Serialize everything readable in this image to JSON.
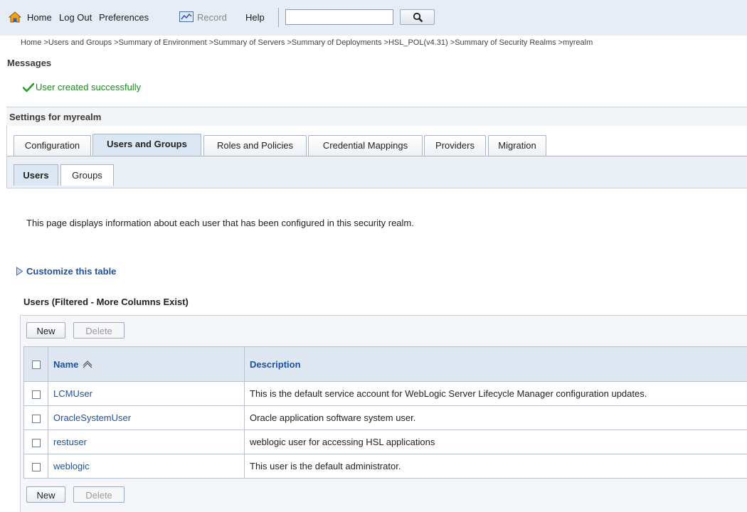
{
  "toolbar": {
    "home": "Home",
    "logout": "Log Out",
    "preferences": "Preferences",
    "record": "Record",
    "help": "Help",
    "search_value": ""
  },
  "breadcrumb": [
    "Home >",
    "Users and Groups >",
    "Summary of Environment >",
    "Summary of Servers >",
    "Summary of Deployments >",
    "HSL_POL(v4.31) >",
    "Summary of Security Realms >",
    "myrealm"
  ],
  "messages": {
    "heading": "Messages",
    "success": "User created successfully"
  },
  "settings": {
    "title": "Settings for myrealm"
  },
  "tabs": [
    "Configuration",
    "Users and Groups",
    "Roles and Policies",
    "Credential Mappings",
    "Providers",
    "Migration"
  ],
  "subtabs": [
    "Users",
    "Groups"
  ],
  "page": {
    "description": "This page displays information about each user that has been configured in this security realm.",
    "customize": "Customize this table",
    "table_title": "Users (Filtered - More Columns Exist)"
  },
  "buttons": {
    "new": "New",
    "delete": "Delete"
  },
  "table": {
    "columns": [
      "Name",
      "Description"
    ],
    "rows": [
      {
        "name": "LCMUser",
        "description": "This is the default service account for WebLogic Server Lifecycle Manager configuration updates."
      },
      {
        "name": "OracleSystemUser",
        "description": "Oracle application software system user."
      },
      {
        "name": "restuser",
        "description": "weblogic user for accessing HSL applications"
      },
      {
        "name": "weblogic",
        "description": "This user is the default administrator."
      }
    ]
  },
  "colors": {
    "link": "#1f4f9b",
    "success": "#1f8a1f",
    "toolbar_bg": "#e6edf6"
  }
}
